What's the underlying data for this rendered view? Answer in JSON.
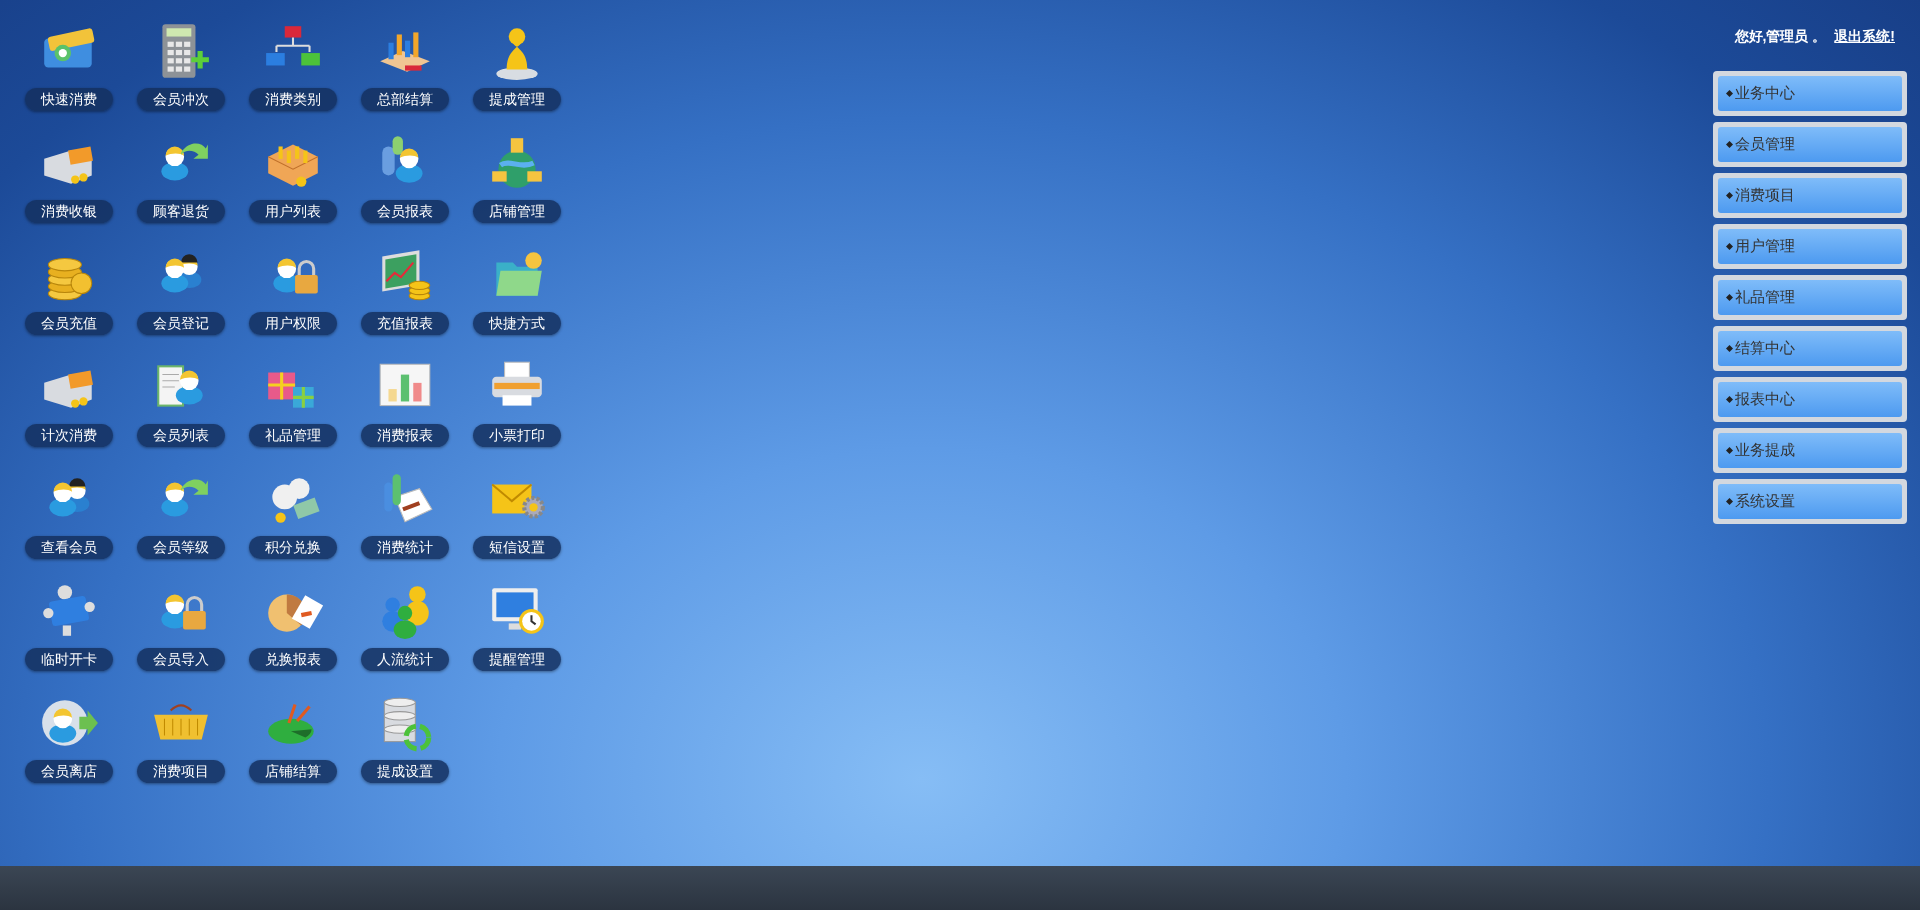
{
  "shortcuts": [
    {
      "label": "快速消费"
    },
    {
      "label": "会员冲次"
    },
    {
      "label": "消费类别"
    },
    {
      "label": "总部结算"
    },
    {
      "label": "提成管理"
    },
    {
      "label": "消费收银"
    },
    {
      "label": "顾客退货"
    },
    {
      "label": "用户列表"
    },
    {
      "label": "会员报表"
    },
    {
      "label": "店铺管理"
    },
    {
      "label": "会员充值"
    },
    {
      "label": "会员登记"
    },
    {
      "label": "用户权限"
    },
    {
      "label": "充值报表"
    },
    {
      "label": "快捷方式"
    },
    {
      "label": "计次消费"
    },
    {
      "label": "会员列表"
    },
    {
      "label": "礼品管理"
    },
    {
      "label": "消费报表"
    },
    {
      "label": "小票打印"
    },
    {
      "label": "查看会员"
    },
    {
      "label": "会员等级"
    },
    {
      "label": "积分兑换"
    },
    {
      "label": "消费统计"
    },
    {
      "label": "短信设置"
    },
    {
      "label": "临时开卡"
    },
    {
      "label": "会员导入"
    },
    {
      "label": "兑换报表"
    },
    {
      "label": "人流统计"
    },
    {
      "label": "提醒管理"
    },
    {
      "label": "会员离店"
    },
    {
      "label": "消费项目"
    },
    {
      "label": "店铺结算"
    },
    {
      "label": "提成设置"
    }
  ],
  "header": {
    "greeting": "您好,管理员 。",
    "logout_link": "退出系统!"
  },
  "menu": [
    {
      "label": "业务中心"
    },
    {
      "label": "会员管理"
    },
    {
      "label": "消费项目"
    },
    {
      "label": "用户管理"
    },
    {
      "label": "礼品管理"
    },
    {
      "label": "结算中心"
    },
    {
      "label": "报表中心"
    },
    {
      "label": "业务提成"
    },
    {
      "label": "系统设置"
    }
  ]
}
